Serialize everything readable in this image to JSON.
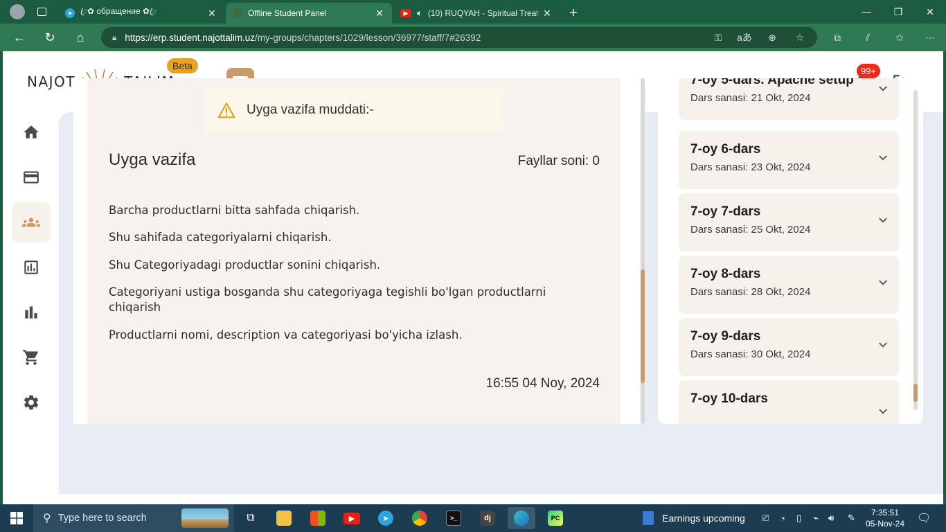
{
  "browser": {
    "tabs": [
      {
        "title": "ꦿ✿ обращение ✿ꦿ",
        "favicon": "telegram-icon"
      },
      {
        "title": "Offline Student Panel",
        "favicon": "najot-icon"
      },
      {
        "title": "(10) RUQYAH - Spiritual Treat",
        "favicon": "youtube-icon"
      }
    ],
    "url_host": "https://erp.student.najottalim.uz",
    "url_path": "/my-groups/chapters/1029/lesson/36977/staff/7#26392"
  },
  "header": {
    "logo_left": "NAJOT",
    "logo_right": "TA'LIM",
    "beta": "Beta",
    "notif_count": "99+"
  },
  "homework": {
    "deadline": "Uyga vazifa muddati:-",
    "title": "Uyga vazifa",
    "files": "Fayllar soni: 0",
    "tasks": [
      "Barcha productlarni bitta sahfada chiqarish.",
      "Shu sahifada categoriyalarni chiqarish.",
      "Shu Categoriyadagi productlar sonini chiqarish.",
      "Categoriyani ustiga bosganda shu categoriyaga tegishli bo'lgan productlarni chiqarish",
      "Productlarni nomi, description va categoriyasi bo'yicha izlash."
    ],
    "datetime": "16:55 04 Noy, 2024"
  },
  "lessons": [
    {
      "name": "7-oy 5-dars. Apache setup",
      "date": "Dars sanasi: 21 Okt, 2024"
    },
    {
      "name": "7-oy 6-dars",
      "date": "Dars sanasi: 23 Okt, 2024"
    },
    {
      "name": "7-oy 7-dars",
      "date": "Dars sanasi: 25 Okt, 2024"
    },
    {
      "name": "7-oy 8-dars",
      "date": "Dars sanasi: 28 Okt, 2024"
    },
    {
      "name": "7-oy 9-dars",
      "date": "Dars sanasi: 30 Okt, 2024"
    },
    {
      "name": "7-oy 10-dars",
      "date": ""
    }
  ],
  "taskbar": {
    "search_placeholder": "Type here to search",
    "earnings": "Earnings upcoming",
    "time": "7:35:51",
    "date": "05-Nov-24"
  },
  "colors": {
    "accent": "#c99a6c",
    "active_nav_bg": "#f7f1ec",
    "lesson_card_bg": "#f7f2ee",
    "deadline_bg": "#fbf7ea",
    "browser_frame": "#2f7a55"
  }
}
